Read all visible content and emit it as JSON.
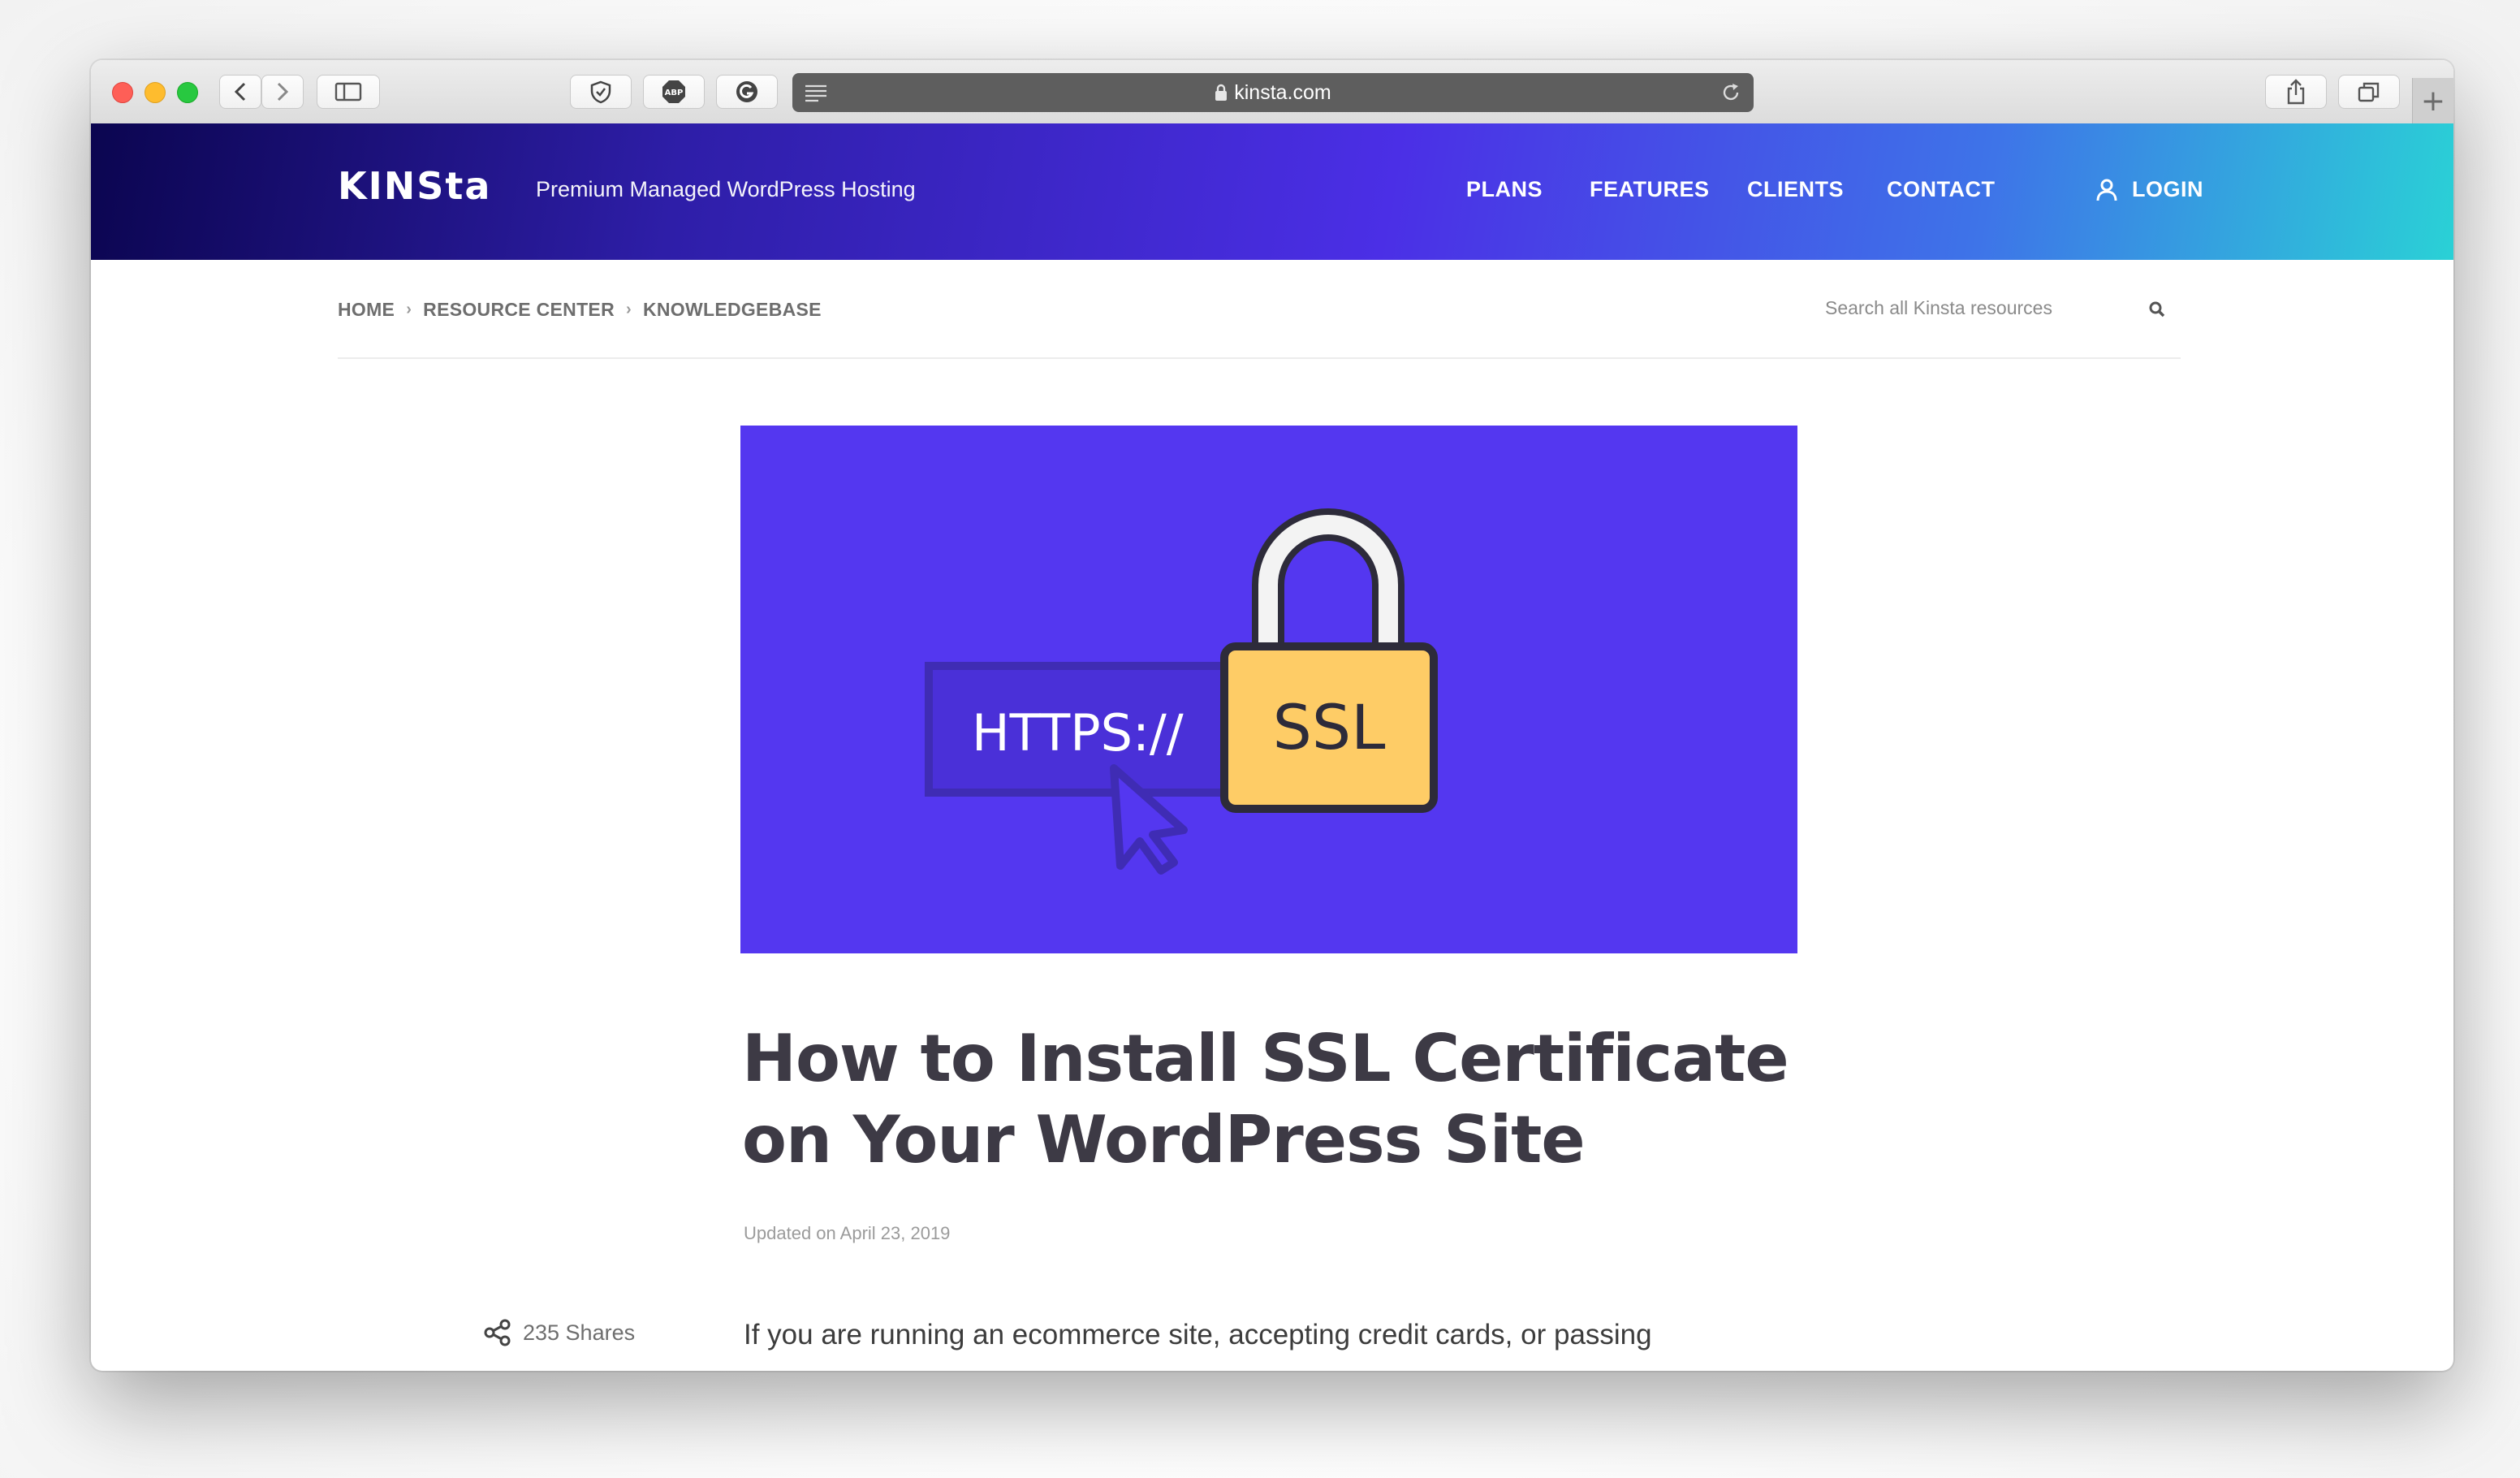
{
  "browser": {
    "url": "kinsta.com"
  },
  "site": {
    "logo": "KINSta",
    "tagline": "Premium Managed WordPress Hosting",
    "nav": {
      "plans": "PLANS",
      "features": "FEATURES",
      "clients": "CLIENTS",
      "contact": "CONTACT",
      "login": "LOGIN"
    }
  },
  "breadcrumb": {
    "items": [
      "HOME",
      "RESOURCE CENTER",
      "KNOWLEDGEBASE"
    ],
    "separator": "›"
  },
  "search": {
    "placeholder": "Search all Kinsta resources"
  },
  "hero": {
    "https_text": "HTTPS://",
    "ssl_text": "SSL",
    "colors": {
      "background": "#5437f0",
      "lock": "#fecc66",
      "outline": "#2d2b3a"
    }
  },
  "article": {
    "title": "How to Install SSL Certificate on Your WordPress Site",
    "updated": "Updated on April 23, 2019",
    "shares": "235 Shares",
    "intro": "If you are running an ecommerce site, accepting credit cards, or passing"
  },
  "colors": {
    "header_start": "#0b0550",
    "header_end": "#2ad1d6",
    "title": "#3d3a45"
  }
}
